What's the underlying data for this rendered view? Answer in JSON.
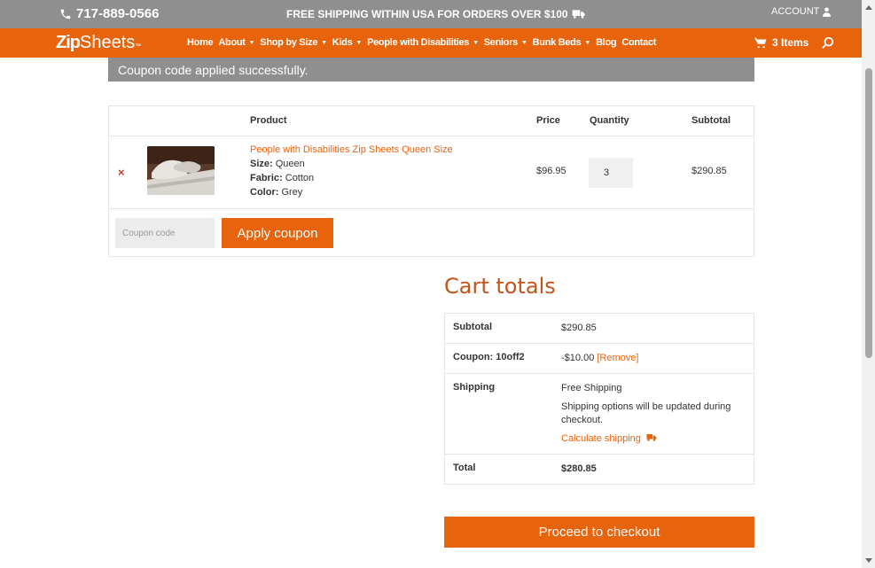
{
  "topbar": {
    "phone": "717-889-0566",
    "promo": "FREE SHIPPING WITHIN USA FOR ORDERS OVER $100",
    "account": "ACCOUNT"
  },
  "logo": {
    "zip": "Zip",
    "sheets": "Sheets",
    "tm": "™"
  },
  "nav": [
    {
      "label": "Home",
      "dropdown": false
    },
    {
      "label": "About",
      "dropdown": true
    },
    {
      "label": "Shop by Size",
      "dropdown": true
    },
    {
      "label": "Kids",
      "dropdown": true
    },
    {
      "label": "People with Disabilities",
      "dropdown": true
    },
    {
      "label": "Seniors",
      "dropdown": true
    },
    {
      "label": "Bunk Beds",
      "dropdown": true
    },
    {
      "label": "Blog",
      "dropdown": false
    },
    {
      "label": "Contact",
      "dropdown": false
    }
  ],
  "cart_link": "3 Items",
  "notice": "Coupon code applied successfully.",
  "table": {
    "headers": {
      "product": "Product",
      "price": "Price",
      "quantity": "Quantity",
      "subtotal": "Subtotal"
    },
    "item": {
      "remove": "×",
      "name": "People with Disabilities Zip Sheets Queen Size",
      "size_label": "Size:",
      "size": "Queen",
      "fabric_label": "Fabric:",
      "fabric": "Cotton",
      "color_label": "Color:",
      "color": "Grey",
      "price": "$96.95",
      "quantity": "3",
      "subtotal": "$290.85"
    },
    "coupon_placeholder": "Coupon code",
    "apply_label": "Apply coupon"
  },
  "totals": {
    "title": "Cart totals",
    "subtotal_label": "Subtotal",
    "subtotal": "$290.85",
    "coupon_label": "Coupon: 10off2",
    "coupon_value": "-$10.00",
    "coupon_remove": "[Remove]",
    "shipping_label": "Shipping",
    "shipping_method": "Free Shipping",
    "shipping_note": "Shipping options will be updated during checkout.",
    "calc_shipping": "Calculate shipping",
    "total_label": "Total",
    "total": "$280.85"
  },
  "checkout_label": "Proceed to checkout",
  "colors": {
    "accent": "#e8640c",
    "topbar": "#8f8f8f",
    "title": "#c4541a"
  }
}
